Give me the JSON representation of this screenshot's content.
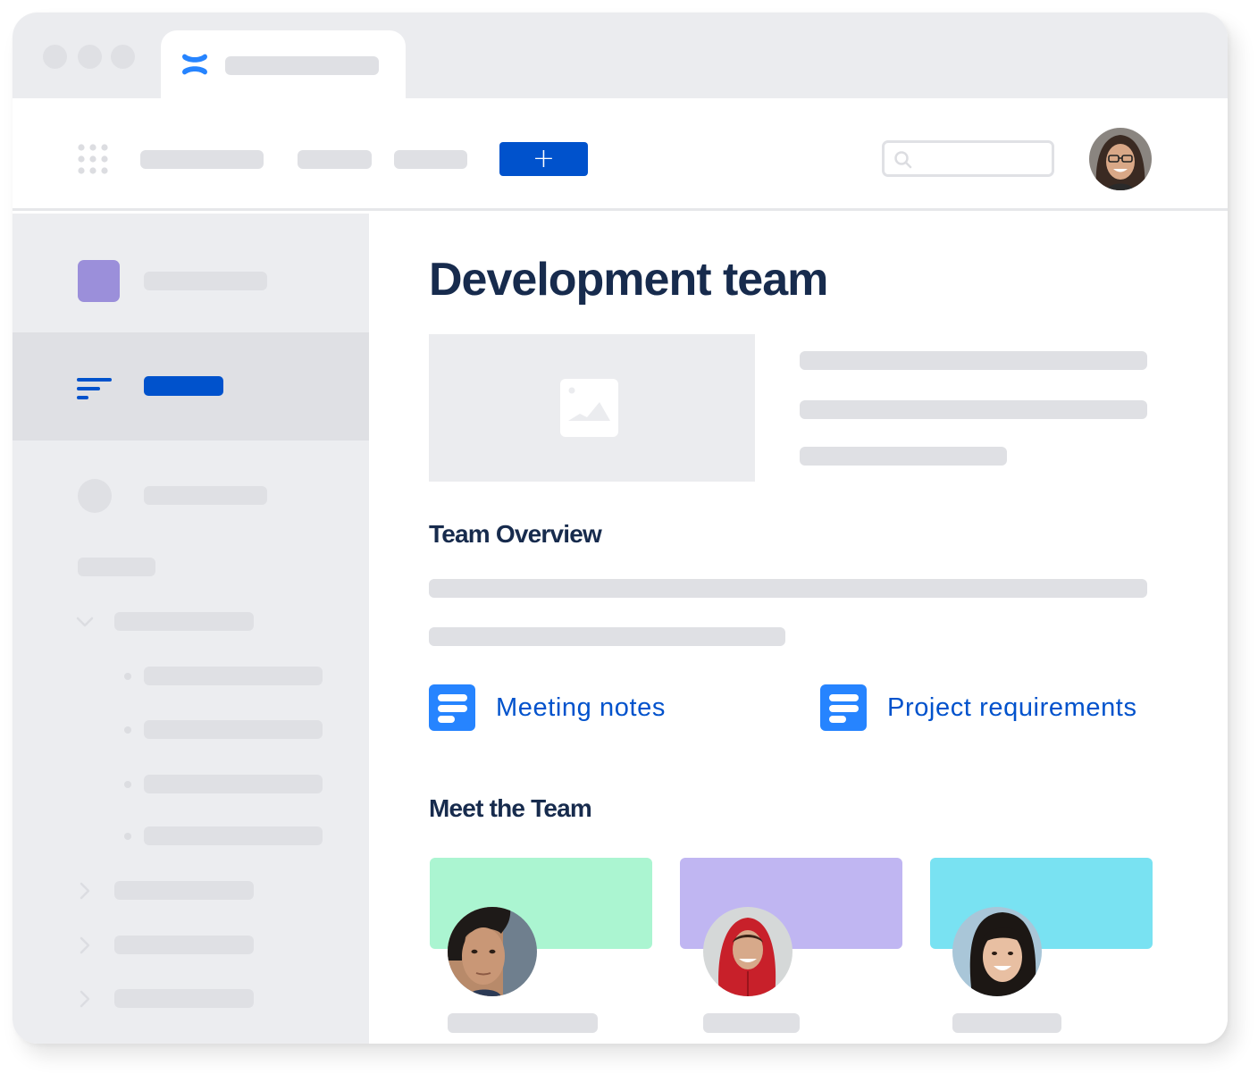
{
  "window": {
    "traffic_lights": [
      "close",
      "minimize",
      "maximize"
    ],
    "tab": {
      "icon": "confluence-logo-icon",
      "title_placeholder": ""
    }
  },
  "header": {
    "apps_icon": "app-switcher-grid-icon",
    "nav_items": [
      "",
      "",
      ""
    ],
    "create_button_label": "+",
    "search": {
      "placeholder": "",
      "value": "",
      "icon": "search-icon"
    },
    "profile_avatar": "user-avatar"
  },
  "sidebar": {
    "space": {
      "icon": "space-avatar-icon",
      "label": "",
      "color": "#9B8FDA"
    },
    "selected_item": {
      "icon": "pages-list-icon",
      "label": "",
      "accent": "#0052CC"
    },
    "items": [
      {
        "type": "circle-icon",
        "label": ""
      },
      {
        "type": "heading",
        "label": ""
      },
      {
        "type": "expanded",
        "icon": "chevron-down-icon",
        "label": "",
        "children": [
          "",
          "",
          "",
          ""
        ]
      },
      {
        "type": "collapsed",
        "icon": "chevron-right-icon",
        "label": ""
      },
      {
        "type": "collapsed",
        "icon": "chevron-right-icon",
        "label": ""
      },
      {
        "type": "collapsed",
        "icon": "chevron-right-icon",
        "label": ""
      }
    ]
  },
  "main": {
    "title": "Development team",
    "hero_image_icon": "image-placeholder-icon",
    "team_overview": {
      "heading": "Team Overview"
    },
    "links": [
      {
        "icon": "document-icon",
        "label": "Meeting notes"
      },
      {
        "icon": "document-icon",
        "label": "Project requirements"
      }
    ],
    "team": {
      "heading": "Meet the Team",
      "members": [
        {
          "banner_color": "#ABF5D1",
          "avatar": "team-member-avatar",
          "name": ""
        },
        {
          "banner_color": "#C0B6F2",
          "avatar": "team-member-avatar",
          "name": ""
        },
        {
          "banner_color": "#79E2F2",
          "avatar": "team-member-avatar",
          "name": ""
        }
      ]
    }
  },
  "colors": {
    "brand_blue": "#0052CC",
    "link_blue": "#0052CC",
    "doc_icon_blue": "#2684FF",
    "heading": "#172B4D",
    "skeleton": "#DFE0E4",
    "sidebar_bg": "#ECEDF0"
  }
}
